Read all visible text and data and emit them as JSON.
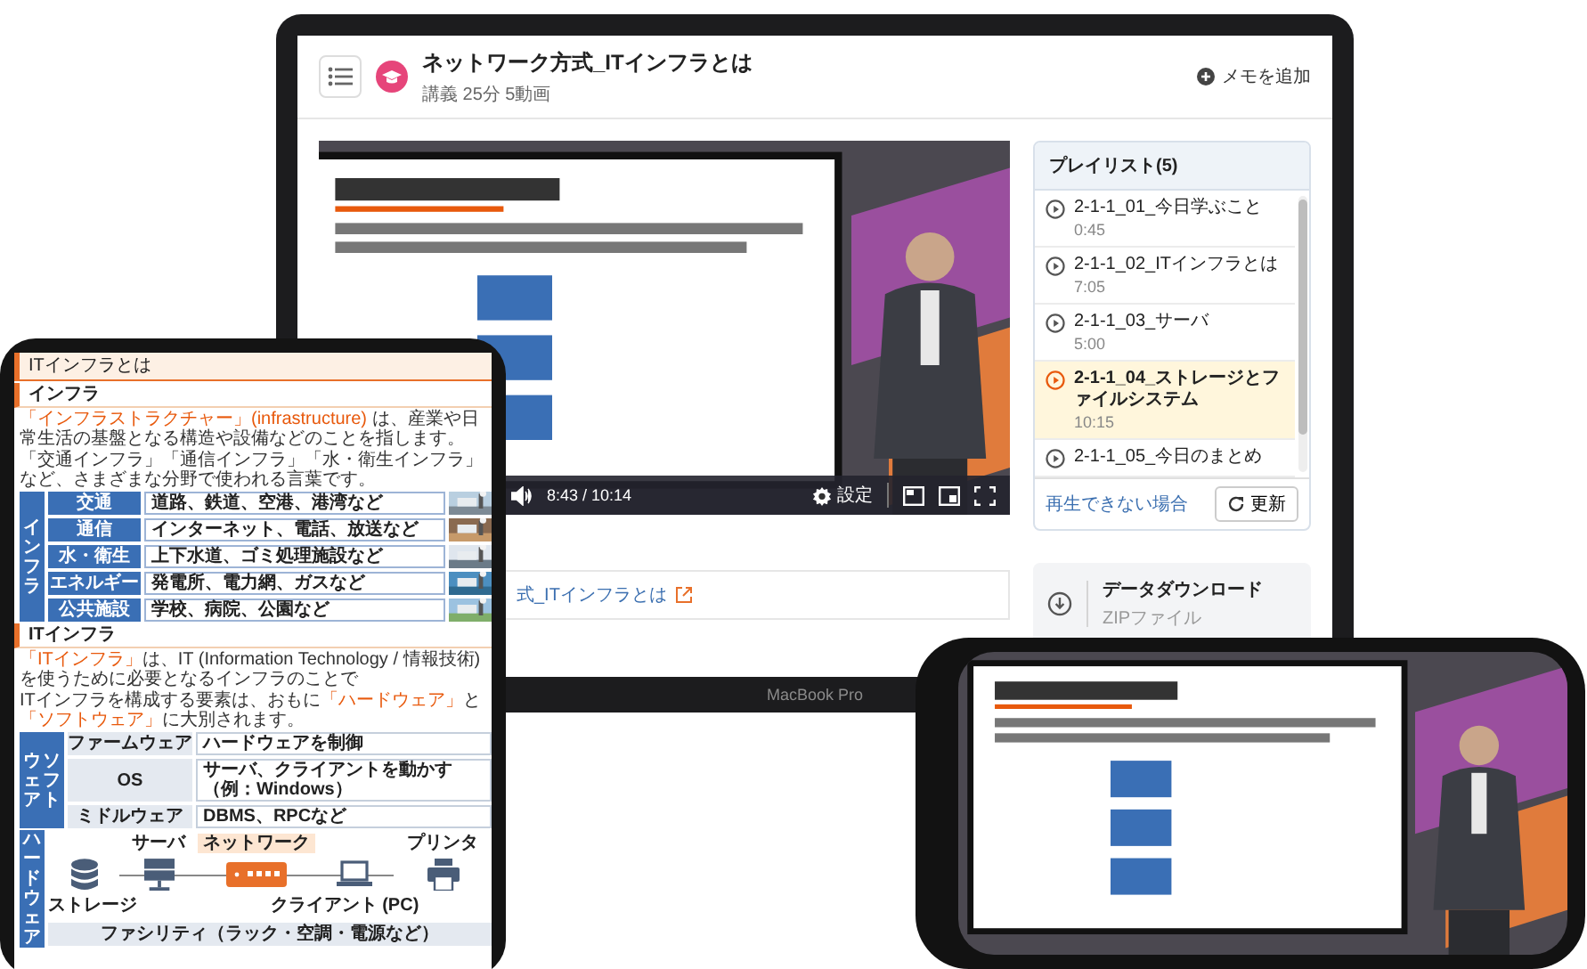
{
  "laptop": {
    "header": {
      "title": "ネットワーク方式_ITインフラとは",
      "meta": "講義 25分 5動画",
      "memo_button": "メモを追加"
    },
    "video": {
      "kind": "picture",
      "time": "8:43 / 10:14",
      "settings": "設定"
    },
    "link": "式_ITインフラとは",
    "playlist": {
      "title": "プレイリスト(5)",
      "items": [
        {
          "title": "2-1-1_01_今日学ぶこと",
          "duration": "0:45",
          "selected": false
        },
        {
          "title": "2-1-1_02_ITインフラとは",
          "duration": "7:05",
          "selected": false
        },
        {
          "title": "2-1-1_03_サーバ",
          "duration": "5:00",
          "selected": false
        },
        {
          "title": "2-1-1_04_ストレージとファイルシステム",
          "duration": "10:15",
          "selected": true
        },
        {
          "title": "2-1-1_05_今日のまとめ",
          "selected": false
        }
      ],
      "help_link": "再生できない場合",
      "refresh_button": "更新"
    },
    "download": {
      "title": "データダウンロード",
      "subtitle": "ZIPファイル"
    },
    "brand": "MacBook Pro"
  },
  "tablet": {
    "title": "ITインフラとは",
    "infra": {
      "heading": "インフラ",
      "paragraphs": [
        "**「インフラストラクチャー」(infrastructure)** は、産業や日常生活の基盤となる構造や設備などのことを指します。",
        "「交通インフラ」「通信インフラ」「水・衛生インフラ」など、さまざまな分野で使われる言葉です。"
      ],
      "group_label": "インフラ",
      "rows": [
        {
          "name": "交通",
          "description": "道路、鉄道、空港、港湾など"
        },
        {
          "name": "通信",
          "description": "インターネット、電話、放送など"
        },
        {
          "name": "水・衛生",
          "description": "上下水道、ゴミ処理施設など"
        },
        {
          "name": "エネルギー",
          "description": "発電所、電力網、ガスなど"
        },
        {
          "name": "公共施設",
          "description": "学校、病院、公園など"
        }
      ]
    },
    "it": {
      "heading": "ITインフラ",
      "paragraphs": [
        "**「ITインフラ」**は、IT (Information Technology / 情報技術) を使うために必要となるインフラのことで",
        "ITインフラを構成する要素は、おもに**「ハードウェア」**と**「ソフトウェア」**に大別されます。"
      ],
      "software": {
        "label_lines": [
          "ウェア",
          "ソフト"
        ],
        "rows": [
          {
            "name": "ファームウェア",
            "description": "ハードウェアを制御"
          },
          {
            "name": "OS",
            "description": "サーバ、クライアントを動かす（例：Windows）"
          },
          {
            "name": "ミドルウェア",
            "description": "DBMS、RPCなど"
          }
        ]
      },
      "hardware": {
        "label": "ハードウェア",
        "server": "サーバ",
        "network": "ネットワーク",
        "printer": "プリンタ",
        "storage": "ストレージ",
        "client": "クライアント (PC)",
        "facility": "ファシリティ（ラック・空調・電源など）"
      }
    }
  }
}
